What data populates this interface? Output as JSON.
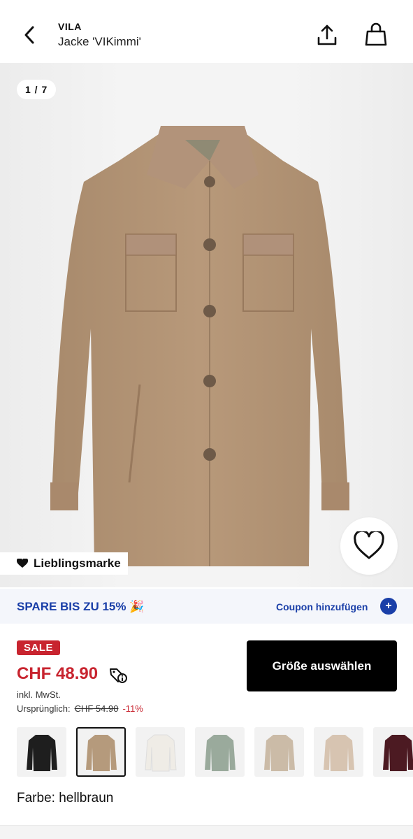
{
  "header": {
    "brand": "VILA",
    "product_name": "Jacke 'VIKimmi'",
    "back_icon": "chevron-left-icon",
    "share_icon": "share-icon",
    "bag_icon": "shopping-bag-icon"
  },
  "gallery": {
    "counter": "1 / 7",
    "favorite_brand_label": "Lieblingsmarke",
    "wishlist_icon": "heart-outline-icon"
  },
  "promo": {
    "text": "SPARE BIS ZU 15% 🎉",
    "coupon_label": "Coupon hinzufügen",
    "coupon_plus": "+"
  },
  "pricing": {
    "sale_badge": "SALE",
    "price": "CHF 48.90",
    "vat_note": "inkl. MwSt.",
    "original_label": "Ursprünglich:",
    "original_price": "CHF 54.90",
    "discount": "-11%"
  },
  "actions": {
    "select_size": "Größe auswählen"
  },
  "colors": {
    "label": "Farbe: hellbraun",
    "swatches": [
      {
        "name": "black",
        "hex": "#1e1e1e",
        "selected": false
      },
      {
        "name": "hellbraun",
        "hex": "#b59a7c",
        "selected": true
      },
      {
        "name": "white",
        "hex": "#efece6",
        "selected": false
      },
      {
        "name": "sage",
        "hex": "#9aaa9c",
        "selected": false
      },
      {
        "name": "beige",
        "hex": "#cbbba7",
        "selected": false
      },
      {
        "name": "light-beige",
        "hex": "#d7c4b1",
        "selected": false
      },
      {
        "name": "burgundy",
        "hex": "#4c1a22",
        "selected": false
      }
    ]
  },
  "theme": {
    "accent_blue": "#1a3fa8",
    "sale_red": "#c8242f",
    "jacket_color": "#b39476"
  }
}
